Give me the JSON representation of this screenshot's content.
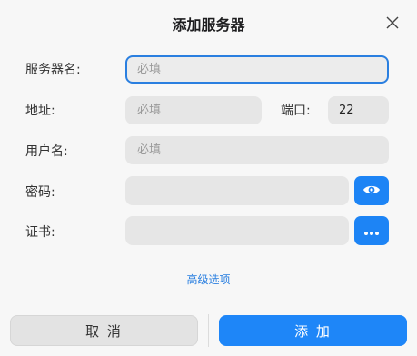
{
  "dialog": {
    "title": "添加服务器",
    "close_icon": "close-icon"
  },
  "form": {
    "server_name": {
      "label": "服务器名:",
      "placeholder": "必填",
      "value": ""
    },
    "address": {
      "label": "地址:",
      "placeholder": "必填",
      "value": ""
    },
    "port": {
      "label": "端口:",
      "value": "22"
    },
    "username": {
      "label": "用户名:",
      "placeholder": "必填",
      "value": ""
    },
    "password": {
      "label": "密码:",
      "value": "",
      "toggle_icon": "eye-icon"
    },
    "certificate": {
      "label": "证书:",
      "value": "",
      "browse_icon": "more-icon"
    }
  },
  "advanced_link": "高级选项",
  "footer": {
    "cancel_label": "取 消",
    "add_label": "添 加"
  },
  "colors": {
    "accent": "#1e86f8",
    "input_bg": "#e6e6e6",
    "dialog_bg": "#f7f7f7"
  }
}
